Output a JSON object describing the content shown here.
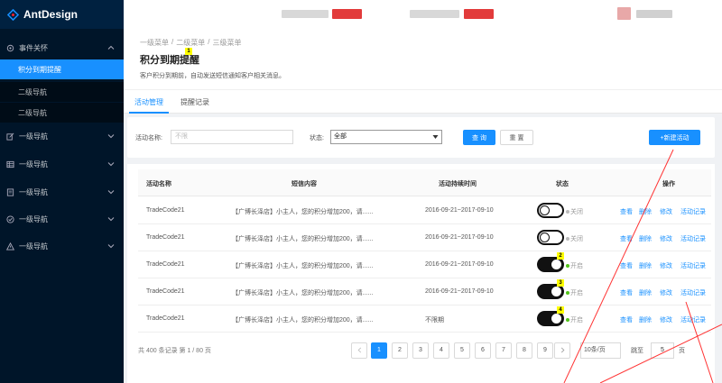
{
  "app": {
    "title": "AntDesign"
  },
  "sidebar": {
    "items": [
      {
        "label": "事件关怀",
        "icon": "settings-icon"
      },
      {
        "label": "一级导航",
        "icon": "edit-icon"
      },
      {
        "label": "一级导航",
        "icon": "table-icon"
      },
      {
        "label": "一级导航",
        "icon": "form-icon"
      },
      {
        "label": "一级导航",
        "icon": "check-circle-icon"
      },
      {
        "label": "一级导航",
        "icon": "warning-icon"
      }
    ],
    "subitems": [
      {
        "label": "积分到期提醒"
      },
      {
        "label": "二级导航"
      },
      {
        "label": "二级导航"
      }
    ]
  },
  "breadcrumb": [
    "一级菜单",
    "二级菜单",
    "三级菜单"
  ],
  "page": {
    "title": "积分到期提醒",
    "description": "客户积分到期前，自动发送短信通知客户相关消息。",
    "pin": "1"
  },
  "tabs": [
    {
      "label": "活动管理"
    },
    {
      "label": "提醒记录"
    }
  ],
  "filter": {
    "name_label": "活动名称:",
    "name_placeholder": "不限",
    "status_label": "状态:",
    "status_value": "全部",
    "query": "查 询",
    "reset": "重 置",
    "new": "+新建活动"
  },
  "table": {
    "headers": [
      "活动名称",
      "短信内容",
      "活动持续时间",
      "状态",
      "操作"
    ],
    "rows": [
      {
        "name": "TradeCode21",
        "content": "【广博长泽店】小主人，您的积分增加200，请......",
        "duration": "2016-09-21~2017-09-10",
        "status": "关闭",
        "on": false,
        "pin": ""
      },
      {
        "name": "TradeCode21",
        "content": "【广博长泽店】小主人，您的积分增加200，请......",
        "duration": "2016-09-21~2017-09-10",
        "status": "关闭",
        "on": false,
        "pin": ""
      },
      {
        "name": "TradeCode21",
        "content": "【广博长泽店】小主人，您的积分增加200，请......",
        "duration": "2016-09-21~2017-09-10",
        "status": "开启",
        "on": true,
        "pin": "2"
      },
      {
        "name": "TradeCode21",
        "content": "【广博长泽店】小主人，您的积分增加200，请......",
        "duration": "2016-09-21~2017-09-10",
        "status": "开启",
        "on": true,
        "pin": "3"
      },
      {
        "name": "TradeCode21",
        "content": "【广博长泽店】小主人，您的积分增加200，请......",
        "duration": "不限期",
        "status": "开启",
        "on": true,
        "pin": "4"
      }
    ],
    "actions": [
      "查看",
      "删除",
      "修改",
      "活动记录"
    ]
  },
  "pagination": {
    "total": "共 400 条记录 第 1 / 80 页",
    "pages": [
      "1",
      "2",
      "3",
      "4",
      "5",
      "6",
      "7",
      "8",
      "9"
    ],
    "current": "1",
    "page_size": "10条/页",
    "jump_label": "跳至",
    "jump_value": "5",
    "jump_unit": "页"
  },
  "colors": {
    "accent": "#1890ff",
    "sidebar": "#001529",
    "annotation": "#ff3333",
    "status_on": "#52c41a"
  }
}
